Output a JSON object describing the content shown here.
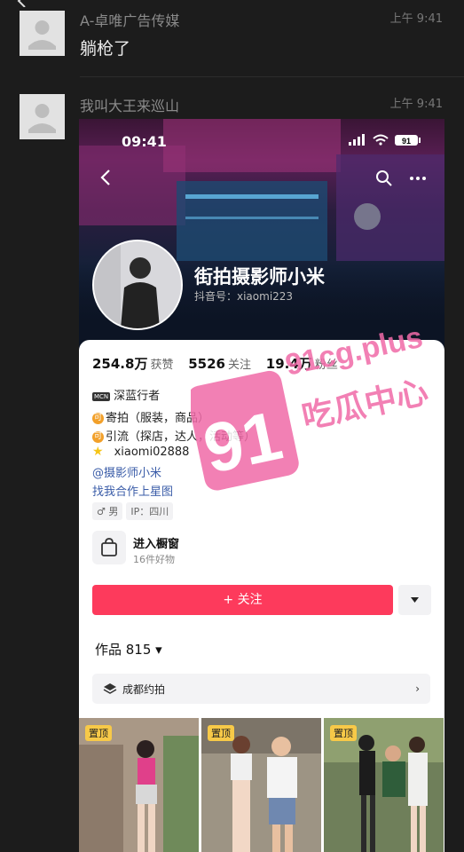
{
  "messages": [
    {
      "sender": "A-卓唯广告传媒",
      "time": "上午 9:41",
      "text": "躺枪了"
    },
    {
      "sender": "我叫大王来巡山",
      "time": "上午 9:41"
    }
  ],
  "shot": {
    "status_time": "09:41",
    "battery": "91",
    "name": "街拍摄影师小米",
    "douyin_id": "抖音号：xiaomi223",
    "stats": [
      {
        "num": "254.8万",
        "label": "获赞"
      },
      {
        "num": "5526",
        "label": "关注"
      },
      {
        "num": "19.4万",
        "label": "粉丝"
      }
    ],
    "mcn_badge": "MCN",
    "mcn_text": "深蓝行者",
    "coin_char": "可",
    "line1": "寄拍（服装，商品）",
    "line2": "引流（探店，达人，活动等）",
    "wx": "xiaomi02888",
    "at": "@摄影师小米",
    "star": "找我合作上星图",
    "gender": "♂ 男",
    "ip": "IP：四川",
    "shop_title": "进入橱窗",
    "shop_sub": "16件好物",
    "follow": "+ 关注",
    "works": "作品 815 ▾",
    "collection": "成都约拍",
    "pin": "置顶"
  },
  "watermark": {
    "line1": "91cg.plus",
    "line2": "吃瓜中心",
    "logo": "91"
  }
}
